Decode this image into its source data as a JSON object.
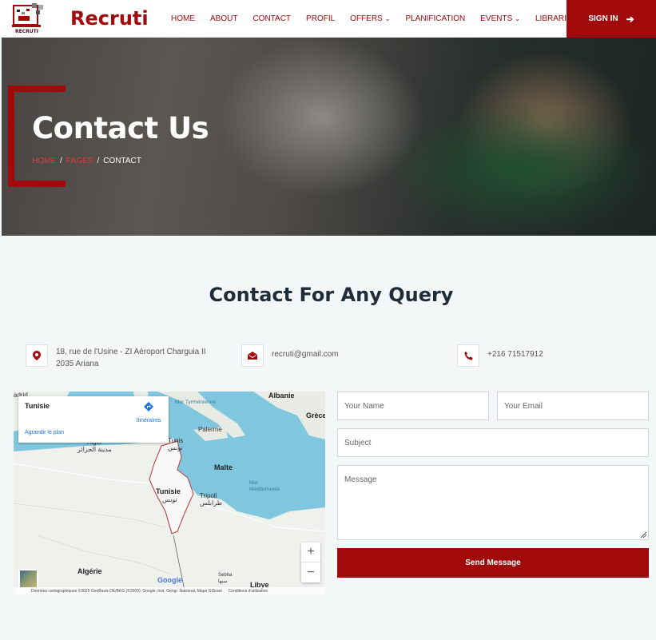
{
  "brand": {
    "name": "Recruti",
    "logo_text": "RECRUTI"
  },
  "nav": {
    "items": [
      {
        "label": "HOME",
        "dropdown": false
      },
      {
        "label": "ABOUT",
        "dropdown": false
      },
      {
        "label": "CONTACT",
        "dropdown": false
      },
      {
        "label": "PROFIL",
        "dropdown": false
      },
      {
        "label": "OFFERS",
        "dropdown": true
      },
      {
        "label": "PLANIFICATION",
        "dropdown": false
      },
      {
        "label": "EVENTS",
        "dropdown": true
      },
      {
        "label": "LIBRARIES",
        "dropdown": true
      }
    ],
    "signin_label": "SIGN IN"
  },
  "hero": {
    "title": "Contact Us",
    "breadcrumb": {
      "home": "HOME",
      "pages": "PAGES",
      "separator": "/",
      "current": "CONTACT"
    }
  },
  "section": {
    "title": "Contact For Any Query"
  },
  "contact_info": {
    "address_line1": "18, rue de l'Usine - ZI Aéroport Charguia II",
    "address_line2": "2035 Ariana",
    "email": "recruti@gmail.com",
    "phone": "+216 71517912"
  },
  "map": {
    "place_name": "Tunisie",
    "directions_label": "Itinéraires",
    "enlarge_label": "Agrandir le plan",
    "labels": {
      "madrid": "adrid",
      "albanie": "Albanie",
      "grece": "Grèce",
      "mer_tyrrhenienne": "Mer Tyrrhénienne",
      "palerme": "Palerme",
      "tunis": "Tunis",
      "tunis_ar": "تونس",
      "alger": "Alger",
      "alger_ar": "مدينة الجزائر",
      "malte": "Malte",
      "tunisie": "Tunisie",
      "tunisie_ar": "تونس",
      "tripoli": "Tripoli",
      "tripoli_ar": "طرابلس",
      "mer_med_1": "Mer",
      "mer_med_2": "Méditerranée",
      "algerie": "Algérie",
      "sebha": "Sebha",
      "sebha_ar": "سبها",
      "libye": "Libye"
    },
    "google": "Google",
    "attribution": "Données cartographiques ©2025 GeoBasis-DE/BKG (©2009), Google, Inst. Geogr. Nacional, Mapa GISrael",
    "terms": "Conditions d'utilisation"
  },
  "form": {
    "name_placeholder": "Your Name",
    "email_placeholder": "Your Email",
    "subject_placeholder": "Subject",
    "message_placeholder": "Message",
    "submit_label": "Send Message"
  },
  "colors": {
    "accent": "#a10a0a",
    "background": "#f4f7f8",
    "heading": "#1f2d3a"
  }
}
